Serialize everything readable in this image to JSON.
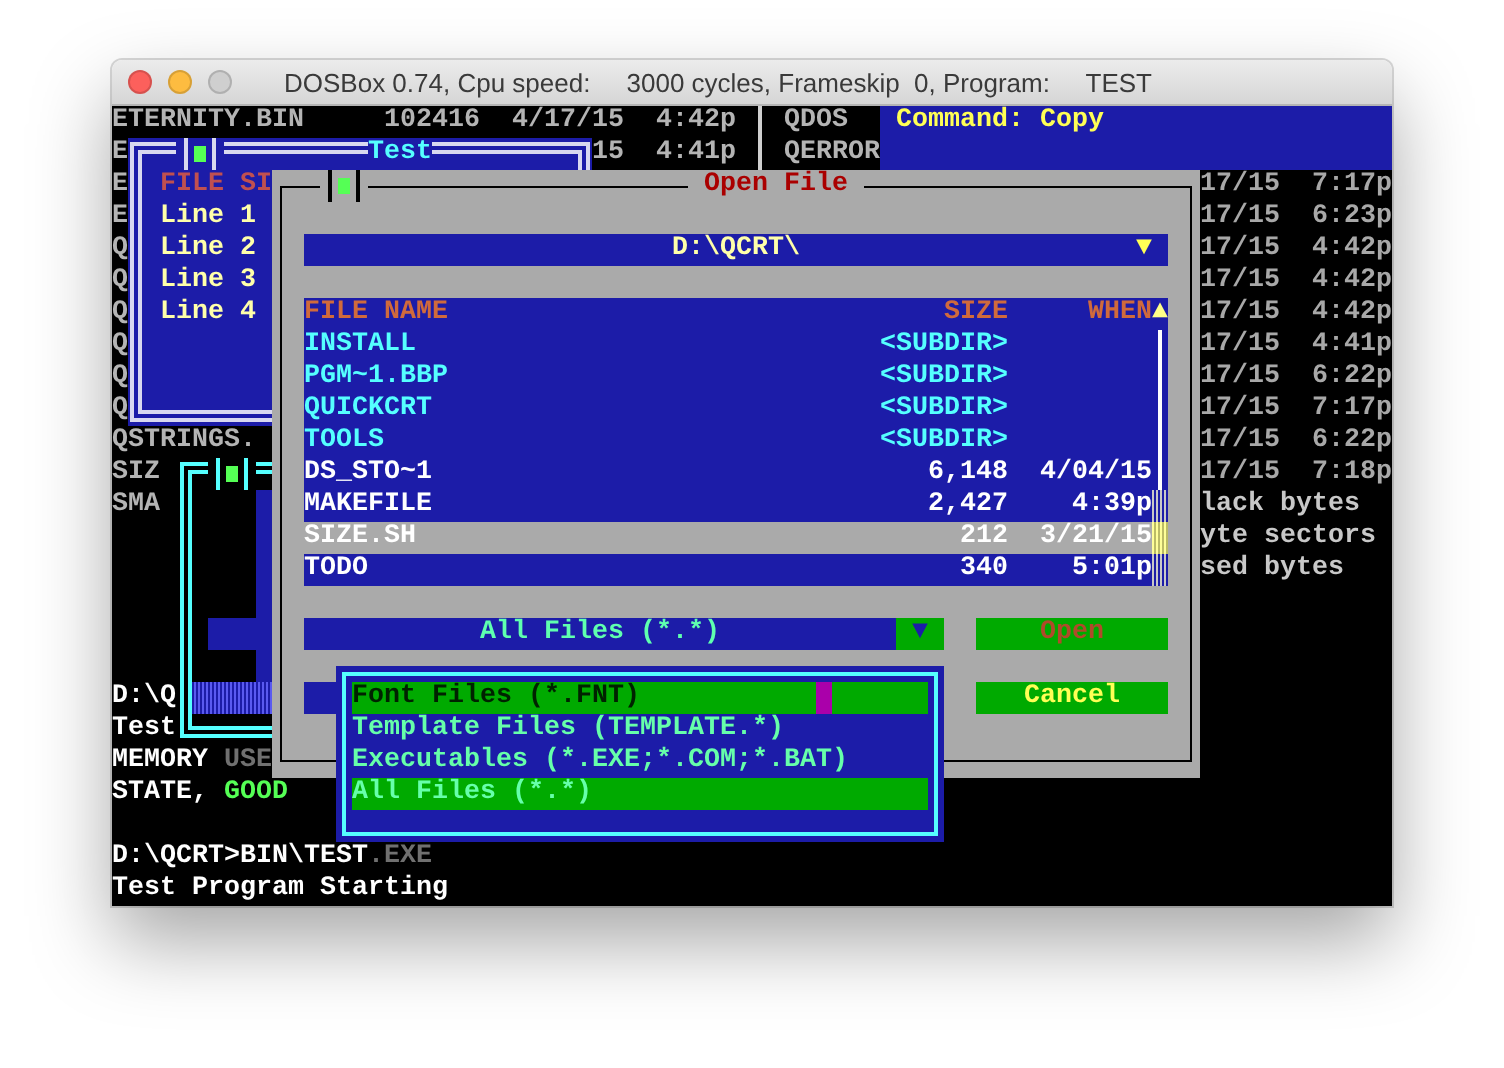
{
  "window": {
    "title": "DOSBox 0.74, Cpu speed:     3000 cycles, Frameskip  0, Program:     TEST"
  },
  "console": {
    "top_rows": [
      {
        "name": "ETERNITY.BIN",
        "size": "102416",
        "date": "4/17/15",
        "time": "4:42p",
        "side": "QDOS"
      },
      {
        "date": "15",
        "time": "4:41p",
        "side": "QERROR"
      }
    ],
    "command": "Command: Copy",
    "left_edge": [
      "E",
      "E",
      "E",
      "Q",
      "Q",
      "Q",
      "Q",
      "Q",
      "Q"
    ],
    "lower_left": [
      [
        {
          "text": "QSTRINGS.",
          "kind": "normal"
        }
      ],
      [
        {
          "text": "SIZ",
          "kind": "normal"
        }
      ],
      [
        {
          "text": "SMA",
          "kind": "normal"
        }
      ]
    ],
    "messages": [
      [
        {
          "text": "D:\\Q",
          "kind": "bright"
        }
      ],
      [
        {
          "text": "Test",
          "kind": "bright"
        }
      ],
      [
        {
          "text": "MEMORY ",
          "kind": "bright"
        },
        {
          "text": "USE",
          "kind": "dim"
        }
      ],
      [
        {
          "text": "STATE, ",
          "kind": "bright"
        },
        {
          "text": "GOOD",
          "kind": "success"
        }
      ]
    ],
    "prompt": [
      [
        {
          "text": "D:\\QCRT>BIN\\TEST",
          "kind": "bright"
        },
        {
          "text": ".EXE",
          "kind": "dim"
        }
      ],
      [
        {
          "text": "Test Program Starting",
          "kind": "bright"
        }
      ]
    ],
    "right_lines": [
      "17/15  7:17p",
      "17/15  6:23p",
      "17/15  4:42p",
      "17/15  4:42p",
      "17/15  4:42p",
      "17/15  4:41p",
      "17/15  6:22p",
      "17/15  7:17p",
      "17/15  6:22p",
      "17/15  7:18p"
    ],
    "right_notes": [
      "lack bytes",
      "yte sectors",
      "sed bytes"
    ]
  },
  "test_window": {
    "title": "Test",
    "header": "FILE SI",
    "lines": [
      "Line 1",
      "Line 2",
      "Line 3",
      "Line 4"
    ]
  },
  "open_dialog": {
    "title": "Open File",
    "path": "D:\\QCRT\\",
    "path_arrow": "▼",
    "columns": [
      "FILE NAME",
      "SIZE",
      "WHEN"
    ],
    "scroll_arrow": "▲",
    "files": [
      {
        "name": "INSTALL",
        "size": "<SUBDIR>",
        "kind": "dir",
        "selected": false
      },
      {
        "name": "PGM~1.BBP",
        "size": "<SUBDIR>",
        "kind": "dir",
        "selected": false
      },
      {
        "name": "QUICKCRT",
        "size": "<SUBDIR>",
        "kind": "dir",
        "selected": false
      },
      {
        "name": "TOOLS",
        "size": "<SUBDIR>",
        "kind": "dir",
        "selected": false
      },
      {
        "name": "DS_STO~1",
        "size": "6,148",
        "when": "4/04/15",
        "kind": "file",
        "selected": false
      },
      {
        "name": "MAKEFILE",
        "size": "2,427",
        "when": "4:39p",
        "kind": "file",
        "selected": false
      },
      {
        "name": "SIZE.SH",
        "size": "212",
        "when": "3/21/15",
        "kind": "file",
        "selected": true
      },
      {
        "name": "TODO",
        "size": "340",
        "when": "5:01p",
        "kind": "file",
        "selected": false
      }
    ],
    "filter": "All Files (*.*)",
    "filter_arrow": "▼",
    "buttons": [
      {
        "label": "Open",
        "disabled": true
      },
      {
        "label": "Cancel",
        "disabled": false
      }
    ]
  },
  "filter_menu": {
    "options": [
      {
        "label": "Font Files (*.FNT)",
        "selected": true,
        "current": false
      },
      {
        "label": "Template Files (TEMPLATE.*)",
        "selected": false,
        "current": false
      },
      {
        "label": "Executables (*.EXE;*.COM;*.BAT)",
        "selected": false,
        "current": false
      },
      {
        "label": "All Files (*.*)",
        "selected": false,
        "current": true
      }
    ]
  }
}
